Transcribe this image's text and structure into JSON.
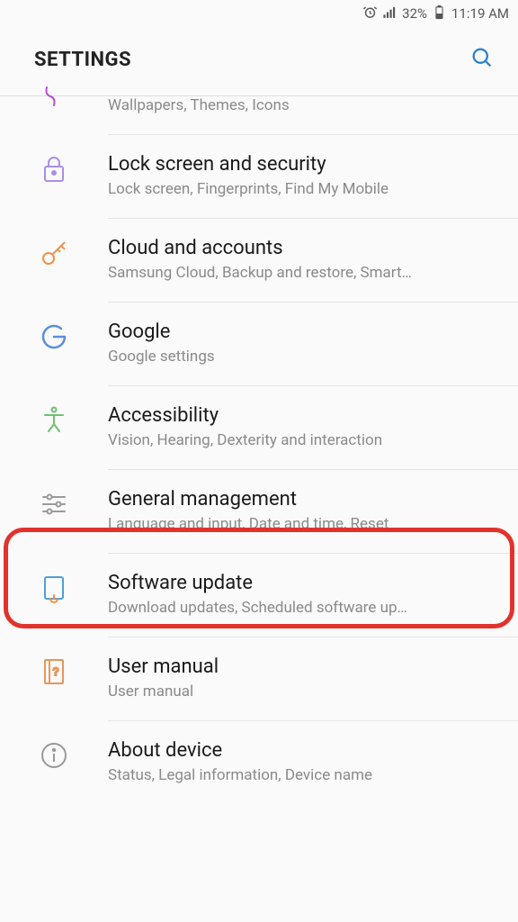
{
  "status": {
    "battery_pct": "32%",
    "time": "11:19 AM"
  },
  "header": {
    "title": "SETTINGS"
  },
  "items": [
    {
      "key": "wallpapers",
      "title": "",
      "sub": "Wallpapers, Themes, Icons"
    },
    {
      "key": "lock-security",
      "title": "Lock screen and security",
      "sub": "Lock screen, Fingerprints, Find My Mobile"
    },
    {
      "key": "cloud-accounts",
      "title": "Cloud and accounts",
      "sub": "Samsung Cloud, Backup and restore, Smart…"
    },
    {
      "key": "google",
      "title": "Google",
      "sub": "Google settings"
    },
    {
      "key": "accessibility",
      "title": "Accessibility",
      "sub": "Vision, Hearing, Dexterity and interaction"
    },
    {
      "key": "general-management",
      "title": "General management",
      "sub": "Language and input, Date and time, Reset"
    },
    {
      "key": "software-update",
      "title": "Software update",
      "sub": "Download updates, Scheduled software up…"
    },
    {
      "key": "user-manual",
      "title": "User manual",
      "sub": "User manual"
    },
    {
      "key": "about-device",
      "title": "About device",
      "sub": "Status, Legal information, Device name"
    }
  ]
}
